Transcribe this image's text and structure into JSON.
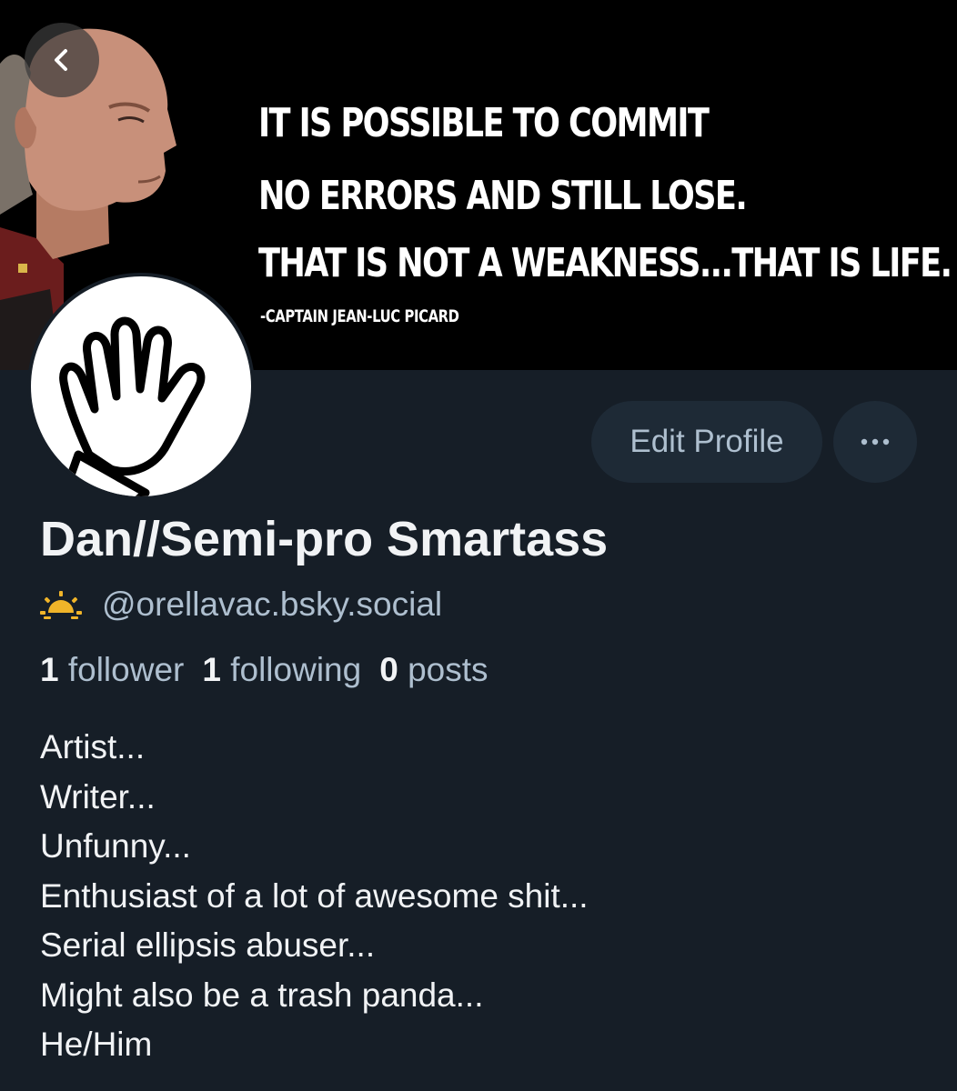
{
  "banner": {
    "quote_lines": [
      "IT IS POSSIBLE TO COMMIT",
      "NO ERRORS AND STILL LOSE.",
      "THAT IS NOT A WEAKNESS...THAT IS LIFE."
    ],
    "attribution": "-CAPTAIN JEAN-LUC PICARD"
  },
  "nav": {
    "back_icon": "chevron-left-icon"
  },
  "actions": {
    "edit_profile_label": "Edit Profile",
    "more_icon": "ellipsis-icon"
  },
  "profile": {
    "display_name": "Dan//Semi-pro Smartass",
    "handle": "@orellavac.bsky.social",
    "handle_icon": "sunrise-icon",
    "accent_color": "#f0b429",
    "stats": {
      "followers_count": "1",
      "followers_label": "follower",
      "following_count": "1",
      "following_label": "following",
      "posts_count": "0",
      "posts_label": "posts"
    },
    "bio": {
      "lines": [
        "Artist...",
        "Writer...",
        "Unfunny...",
        "Enthusiast of a lot of awesome shit...",
        "Serial ellipsis abuser...",
        "Might also be a trash panda...",
        "He/Him"
      ]
    }
  },
  "colors": {
    "background": "#161e27",
    "button_bg": "#1e2a36",
    "secondary_text": "#aebfcf",
    "primary_text": "#f1f3f5"
  }
}
